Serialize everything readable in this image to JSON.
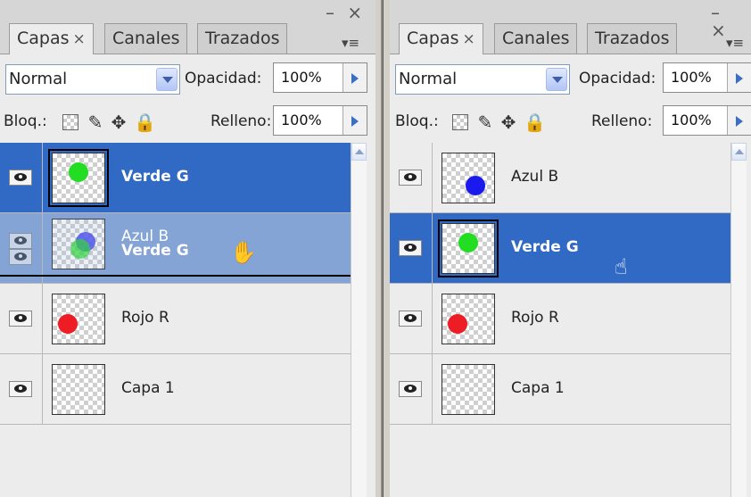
{
  "left_panel": {
    "tabs": [
      {
        "label": "Capas",
        "close": "×"
      },
      {
        "label": "Canales"
      },
      {
        "label": "Trazados"
      }
    ],
    "window_controls": "– ×",
    "menu_icon": "▾≡",
    "blend_mode": "Normal",
    "opacity_label": "Opacidad:",
    "opacity_value": "100%",
    "lock_label": "Bloq.:",
    "fill_label": "Relleno:",
    "fill_value": "100%",
    "layers": [
      {
        "name": "Verde G",
        "selected": true,
        "dot_color": "#22dd22"
      },
      {
        "name": "Azul B",
        "name2": "Verde G",
        "dragging": true
      },
      {
        "name": "Rojo R",
        "dot_color": "#ee1c24"
      },
      {
        "name": "Capa 1"
      }
    ]
  },
  "right_panel": {
    "tabs": [
      {
        "label": "Capas",
        "close": "×"
      },
      {
        "label": "Canales"
      },
      {
        "label": "Trazados"
      }
    ],
    "window_controls": "– ×",
    "menu_icon": "▾≡",
    "blend_mode": "Normal",
    "opacity_label": "Opacidad:",
    "opacity_value": "100%",
    "lock_label": "Bloq.:",
    "fill_label": "Relleno:",
    "fill_value": "100%",
    "layers": [
      {
        "name": "Azul B",
        "dot_color": "#1a1aee"
      },
      {
        "name": "Verde G",
        "selected": true,
        "dot_color": "#22dd22"
      },
      {
        "name": "Rojo R",
        "dot_color": "#ee1c24"
      },
      {
        "name": "Capa 1"
      }
    ]
  },
  "icons": {
    "visibility": "eye-icon",
    "lock_transparency": "lock-transparent-pixels-icon",
    "lock_image": "brush-icon",
    "lock_position": "move-icon",
    "lock_all": "padlock-icon",
    "cursor_left": "grab-hand-icon",
    "cursor_right": "pointing-hand-icon"
  },
  "colors": {
    "selection": "#316ac5",
    "drag_highlight": "#7d9ad8"
  }
}
